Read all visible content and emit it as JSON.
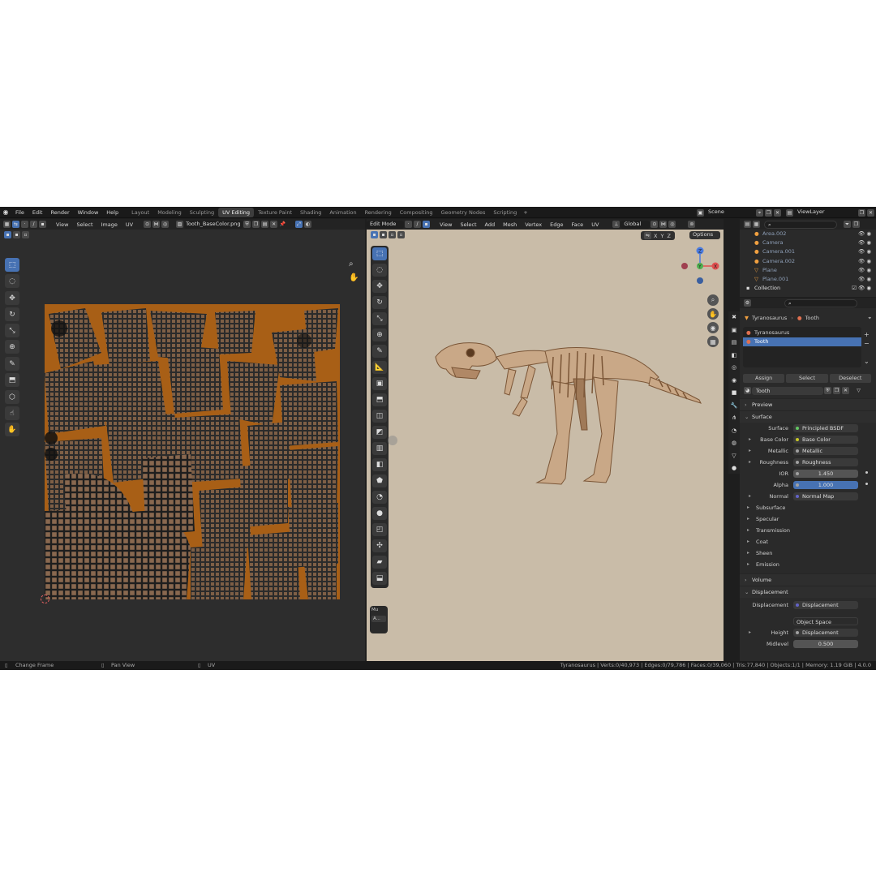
{
  "menubar": {
    "items": [
      "File",
      "Edit",
      "Render",
      "Window",
      "Help"
    ],
    "workspaces": [
      "Layout",
      "Modeling",
      "Sculpting",
      "UV Editing",
      "Texture Paint",
      "Shading",
      "Animation",
      "Rendering",
      "Compositing",
      "Geometry Nodes",
      "Scripting"
    ],
    "active_workspace": "UV Editing",
    "add_tab": "+",
    "scene": "Scene",
    "view_layer": "ViewLayer"
  },
  "uv_editor": {
    "menus": [
      "View",
      "Select",
      "Image",
      "UV"
    ],
    "image_name": "Tooth_BaseColor.png",
    "texture_color": "#b0661a"
  },
  "viewport": {
    "mode": "Edit Mode",
    "menus": [
      "View",
      "Select",
      "Add",
      "Mesh",
      "Vertex",
      "Edge",
      "Face",
      "UV"
    ],
    "orientation": "Global",
    "axes": [
      "X",
      "Y",
      "Z"
    ],
    "options_label": "Options",
    "mini_panel": {
      "label": "Mu",
      "button": "A..."
    },
    "gizmo": {
      "x": "X",
      "y": "Y",
      "z": "Z"
    },
    "background": "#c9bca8"
  },
  "outliner": {
    "items": [
      "Area.002",
      "Camera",
      "Camera.001",
      "Camera.002",
      "Plane",
      "Plane.001"
    ],
    "collection": "Collection"
  },
  "properties": {
    "breadcrumb": {
      "object": "Tyranosaurus",
      "material": "Tooth"
    },
    "material_slots": [
      "Tyranosaurus",
      "Tooth"
    ],
    "active_slot": "Tooth",
    "buttons": {
      "assign": "Assign",
      "select": "Select",
      "deselect": "Deselect"
    },
    "material_name": "Tooth",
    "sections": {
      "preview": "Preview",
      "surface": "Surface",
      "volume": "Volume",
      "displacement": "Displacement"
    },
    "surface_rows": [
      {
        "label": "Surface",
        "value": "Principled BSDF",
        "socket": "green"
      },
      {
        "label": "Base Color",
        "value": "Base Color",
        "socket": "yellow"
      },
      {
        "label": "Metallic",
        "value": "Metallic",
        "socket": "grey"
      },
      {
        "label": "Roughness",
        "value": "Roughness",
        "socket": "grey"
      },
      {
        "label": "IOR",
        "value": "1.450",
        "socket": "grey"
      },
      {
        "label": "Alpha",
        "value": "1.000",
        "socket": "grey"
      },
      {
        "label": "Normal",
        "value": "Normal Map",
        "socket": "purple"
      }
    ],
    "subpanels": [
      "Subsurface",
      "Specular",
      "Transmission",
      "Coat",
      "Sheen",
      "Emission"
    ],
    "displacement_rows": {
      "label": "Displacement",
      "value": "Displacement",
      "space": "Object Space",
      "height_label": "Height",
      "height_value": "Displacement",
      "midlevel_label": "Midlevel",
      "midlevel_value": "0.500"
    }
  },
  "statusbar": {
    "left": [
      "Change Frame",
      "Pan View",
      "UV"
    ],
    "right": "Tyranosaurus | Verts:0/40,973 | Edges:0/79,786 | Faces:0/39,060 | Tris:77,840 | Objects:1/1 | Memory: 1.19 GiB | 4.0.0"
  }
}
